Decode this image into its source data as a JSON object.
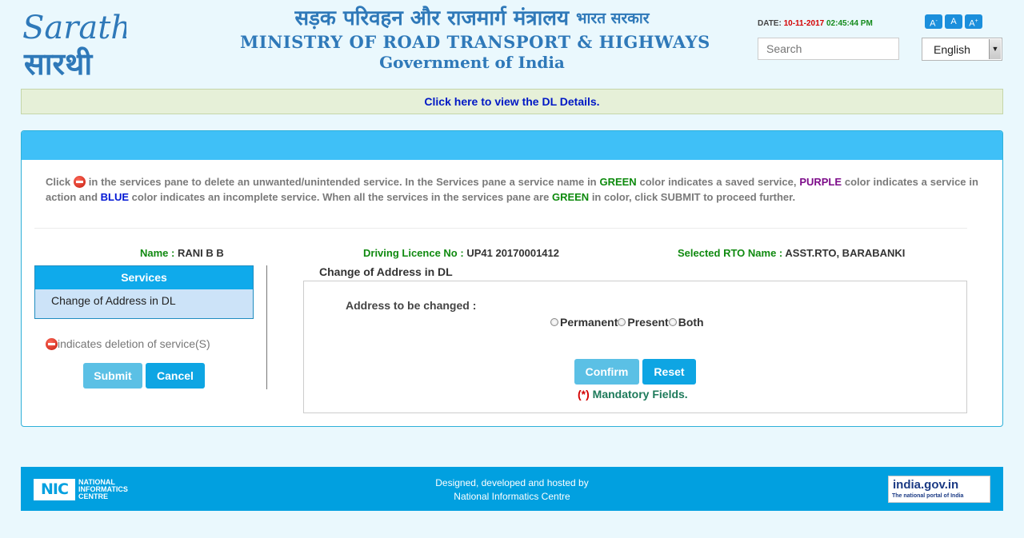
{
  "header": {
    "logo_en": "Sarathi",
    "logo_hi": "सारथी",
    "hindi_title": "सड़क परिवहन और राजमार्ग मंत्रालय",
    "hindi_sub": "भारत सरकार",
    "english_title": "MINISTRY OF ROAD TRANSPORT & HIGHWAYS",
    "govt": "Government of India",
    "date_label": "DATE:",
    "date": "10-11-2017",
    "time": "02:45:44 PM",
    "font_buttons": [
      "A-",
      "A",
      "A+"
    ],
    "search_placeholder": "Search",
    "language": "English"
  },
  "dl_link": "Click here to view the DL Details.",
  "instructions": {
    "p1": "Click",
    "p2": "in the services pane to delete an unwanted/unintended service. In the Services pane a service name in",
    "green": "GREEN",
    "p3": "color indicates a saved service,",
    "purple": "PURPLE",
    "p4": "color indicates a service in action and",
    "blue": "BLUE",
    "p5": "color indicates an incomplete service. When all the services in the services pane are",
    "green2": "GREEN",
    "p6": "in color, click SUBMIT to proceed further."
  },
  "info": {
    "name_label": "Name :",
    "name": "RANI B B",
    "dl_label": "Driving Licence No :",
    "dl_no": "UP41 20170001412",
    "rto_label": "Selected RTO Name :",
    "rto": "ASST.RTO, BARABANKI"
  },
  "services": {
    "header": "Services",
    "items": [
      "Change of Address in DL"
    ],
    "legend": "indicates deletion of service(S)",
    "submit": "Submit",
    "cancel": "Cancel"
  },
  "form": {
    "legend": "Change of Address in DL",
    "address_label": "Address to be changed :",
    "options": [
      "Permanent",
      "Present",
      "Both"
    ],
    "confirm": "Confirm",
    "reset": "Reset",
    "mandatory_star": "(*)",
    "mandatory_text": "Mandatory Fields."
  },
  "footer": {
    "nic_logo": "NIC",
    "nic_lines": [
      "NATIONAL",
      "INFORMATICS",
      "CENTRE"
    ],
    "credit1": "Designed, developed and hosted by",
    "credit2": "National Informatics Centre",
    "indiagov": "india.gov.in",
    "indiagov_sub": "The national portal of India"
  },
  "colors": {
    "accent": "#0faaeb",
    "panel_head": "#3fc0f7",
    "green": "#108a10",
    "footer": "#01a0e0"
  }
}
